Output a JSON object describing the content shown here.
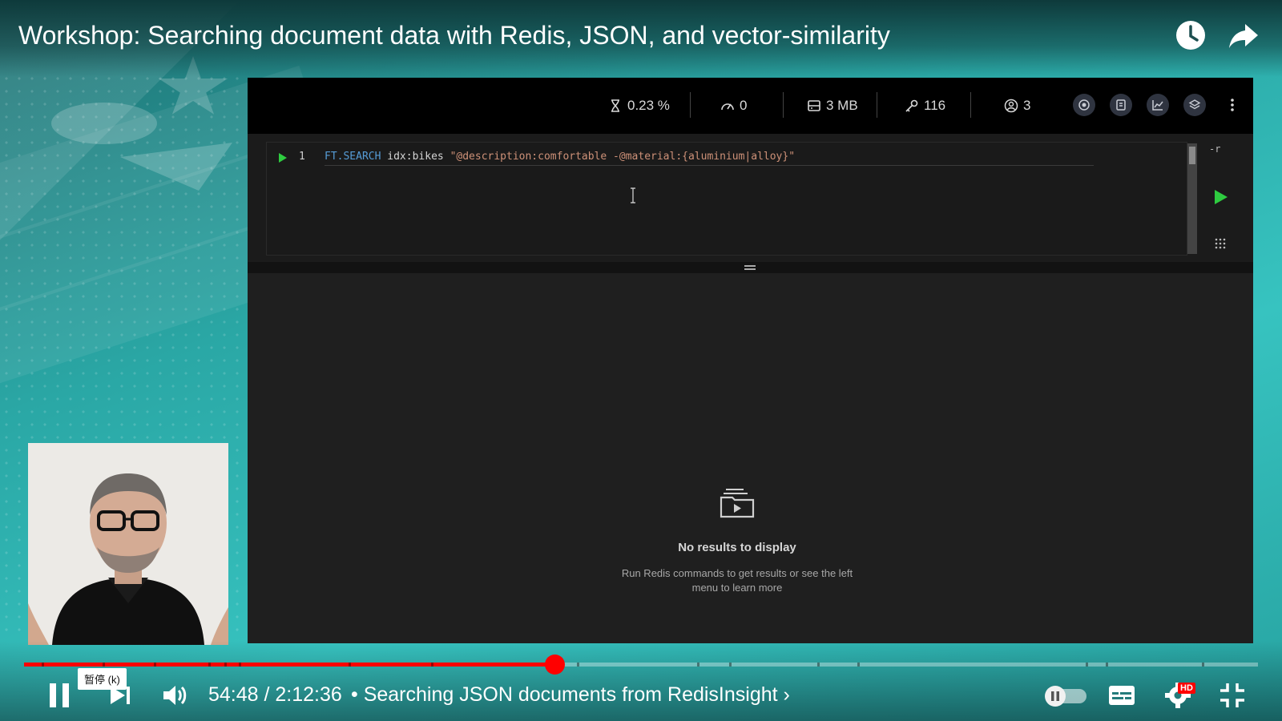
{
  "video": {
    "title": "Workshop: Searching document data with Redis, JSON, and vector-similarity",
    "time": "54:48 / 2:12:36",
    "chapter": "• Searching JSON documents from RedisInsight",
    "chapter_arrow": "›",
    "pause_tooltip": "暂停 (k)",
    "hd_badge": "HD",
    "progress_fraction": 0.43
  },
  "redis_insight": {
    "stats": {
      "cpu": "0.23 %",
      "ops": "0",
      "memory": "3 MB",
      "keys": "116",
      "clients": "3"
    },
    "editor": {
      "line_number": "1",
      "command": "FT.SEARCH",
      "index": "idx:bikes",
      "query": "\"@description:comfortable -@material:{aluminium|alloy}\"",
      "raw_toggle": "-r"
    },
    "results": {
      "empty_title": "No results to display",
      "empty_desc": "Run Redis commands to get results or see the left menu to learn more"
    }
  },
  "colors": {
    "accent": "#ff0000",
    "run_green": "#2ecc40",
    "background_teal": "#2fb3b1"
  }
}
